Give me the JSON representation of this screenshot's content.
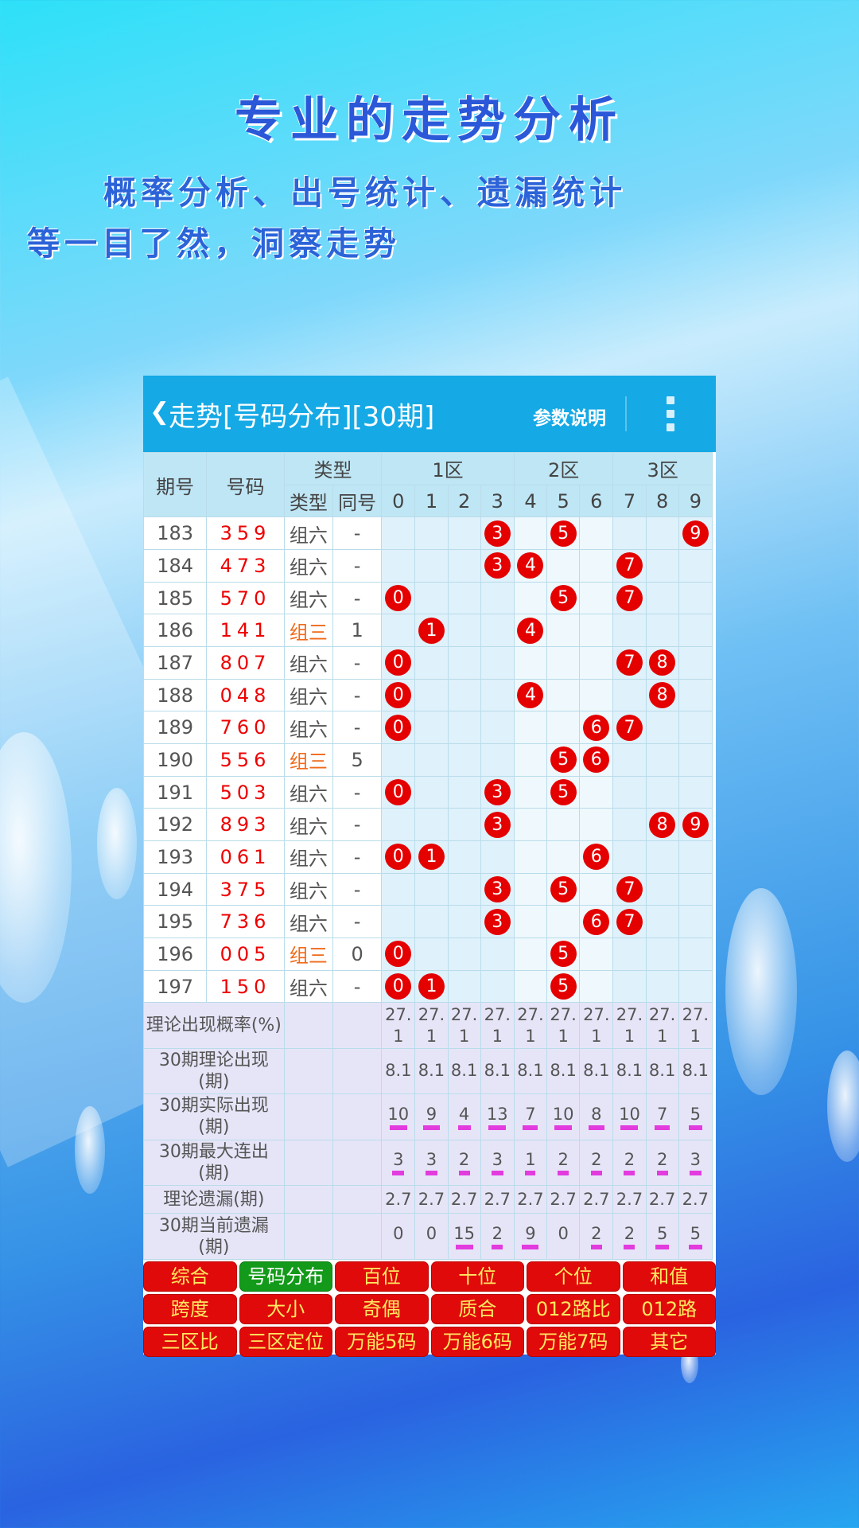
{
  "promo": {
    "title": "专业的走势分析",
    "line1": "概率分析、出号统计、遗漏统计",
    "line2": "等一目了然，洞察走势"
  },
  "app": {
    "title": "走势[号码分布][30期]",
    "help": "参数说明"
  },
  "header": {
    "period": "期号",
    "number": "号码",
    "type": "类型",
    "type_sub": "类型",
    "same_sub": "同号",
    "zones": [
      "1区",
      "2区",
      "3区"
    ],
    "digits": [
      "0",
      "1",
      "2",
      "3",
      "4",
      "5",
      "6",
      "7",
      "8",
      "9"
    ]
  },
  "rows": [
    {
      "period": "183",
      "number": "359",
      "type": "组六",
      "same": "-",
      "hits": [
        3,
        5,
        9
      ],
      "kind": "six"
    },
    {
      "period": "184",
      "number": "473",
      "type": "组六",
      "same": "-",
      "hits": [
        3,
        4,
        7
      ],
      "kind": "six"
    },
    {
      "period": "185",
      "number": "570",
      "type": "组六",
      "same": "-",
      "hits": [
        0,
        5,
        7
      ],
      "kind": "six"
    },
    {
      "period": "186",
      "number": "141",
      "type": "组三",
      "same": "1",
      "hits": [
        1,
        4
      ],
      "kind": "three"
    },
    {
      "period": "187",
      "number": "807",
      "type": "组六",
      "same": "-",
      "hits": [
        0,
        7,
        8
      ],
      "kind": "six"
    },
    {
      "period": "188",
      "number": "048",
      "type": "组六",
      "same": "-",
      "hits": [
        0,
        4,
        8
      ],
      "kind": "six"
    },
    {
      "period": "189",
      "number": "760",
      "type": "组六",
      "same": "-",
      "hits": [
        0,
        6,
        7
      ],
      "kind": "six"
    },
    {
      "period": "190",
      "number": "556",
      "type": "组三",
      "same": "5",
      "hits": [
        5,
        6
      ],
      "kind": "three"
    },
    {
      "period": "191",
      "number": "503",
      "type": "组六",
      "same": "-",
      "hits": [
        0,
        3,
        5
      ],
      "kind": "six"
    },
    {
      "period": "192",
      "number": "893",
      "type": "组六",
      "same": "-",
      "hits": [
        3,
        8,
        9
      ],
      "kind": "six"
    },
    {
      "period": "193",
      "number": "061",
      "type": "组六",
      "same": "-",
      "hits": [
        0,
        1,
        6
      ],
      "kind": "six"
    },
    {
      "period": "194",
      "number": "375",
      "type": "组六",
      "same": "-",
      "hits": [
        3,
        5,
        7
      ],
      "kind": "six"
    },
    {
      "period": "195",
      "number": "736",
      "type": "组六",
      "same": "-",
      "hits": [
        3,
        6,
        7
      ],
      "kind": "six"
    },
    {
      "period": "196",
      "number": "005",
      "type": "组三",
      "same": "0",
      "hits": [
        0,
        5
      ],
      "kind": "three"
    },
    {
      "period": "197",
      "number": "150",
      "type": "组六",
      "same": "-",
      "hits": [
        0,
        1,
        5
      ],
      "kind": "six"
    }
  ],
  "stats": [
    {
      "label": "理论出现概率(%)",
      "values": [
        "27.1",
        "27.1",
        "27.1",
        "27.1",
        "27.1",
        "27.1",
        "27.1",
        "27.1",
        "27.1",
        "27.1"
      ],
      "bars": false
    },
    {
      "label": "30期理论出现(期)",
      "values": [
        "8.1",
        "8.1",
        "8.1",
        "8.1",
        "8.1",
        "8.1",
        "8.1",
        "8.1",
        "8.1",
        "8.1"
      ],
      "bars": false
    },
    {
      "label": "30期实际出现(期)",
      "values": [
        "10",
        "9",
        "4",
        "13",
        "7",
        "10",
        "8",
        "10",
        "7",
        "5"
      ],
      "bars": true
    },
    {
      "label": "30期最大连出(期)",
      "values": [
        "3",
        "3",
        "2",
        "3",
        "1",
        "2",
        "2",
        "2",
        "2",
        "3"
      ],
      "bars": true
    },
    {
      "label": "理论遗漏(期)",
      "values": [
        "2.7",
        "2.7",
        "2.7",
        "2.7",
        "2.7",
        "2.7",
        "2.7",
        "2.7",
        "2.7",
        "2.7"
      ],
      "bars": false
    },
    {
      "label": "30期当前遗漏(期)",
      "values": [
        "0",
        "0",
        "15",
        "2",
        "9",
        "0",
        "2",
        "2",
        "5",
        "5"
      ],
      "bars": true
    }
  ],
  "buttons": [
    "综合",
    "号码分布",
    "百位",
    "十位",
    "个位",
    "和值",
    "跨度",
    "大小",
    "奇偶",
    "质合",
    "012路比",
    "012路",
    "三区比",
    "三区定位",
    "万能5码",
    "万能6码",
    "万能7码",
    "其它"
  ],
  "active_button": "号码分布",
  "colors": {
    "appbar": "#15a9e6",
    "ball": "#e50000",
    "bar": "#e23bde",
    "button": "#e00a0a",
    "button_active": "#139a1a"
  }
}
